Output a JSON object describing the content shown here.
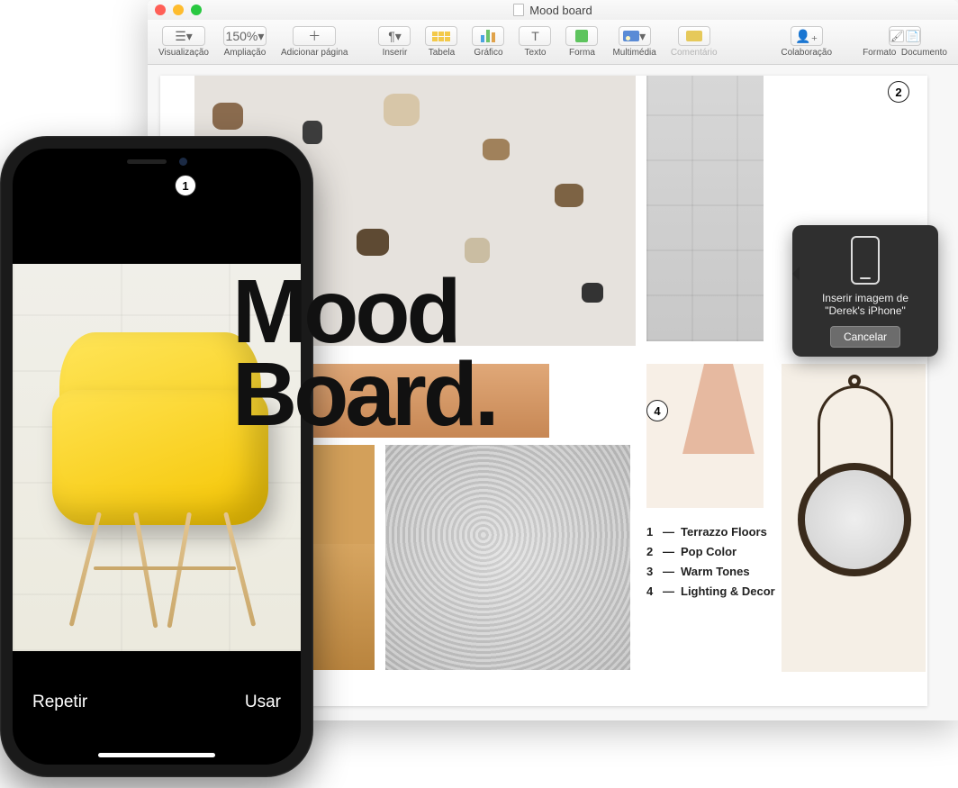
{
  "window": {
    "title": "Mood board"
  },
  "toolbar": {
    "view": "Visualização",
    "zoom_value": "150%",
    "zoom_label": "Ampliação",
    "add_page": "Adicionar página",
    "insert": "Inserir",
    "table": "Tabela",
    "chart": "Gráfico",
    "text": "Texto",
    "shape": "Forma",
    "media": "Multimédia",
    "comment": "Comentário",
    "collab": "Colaboração",
    "format": "Formato",
    "document": "Documento"
  },
  "document": {
    "title_line1": "Mood",
    "title_line2": "Board.",
    "markers": {
      "m1": "1",
      "m2": "2",
      "m4": "4"
    },
    "legend": [
      {
        "n": "1",
        "label": "Terrazzo Floors"
      },
      {
        "n": "2",
        "label": "Pop Color"
      },
      {
        "n": "3",
        "label": "Warm Tones"
      },
      {
        "n": "4",
        "label": "Lighting & Decor"
      }
    ]
  },
  "popover": {
    "text": "Inserir imagem de \"Derek's iPhone\"",
    "cancel": "Cancelar"
  },
  "iphone": {
    "retake": "Repetir",
    "use": "Usar"
  }
}
